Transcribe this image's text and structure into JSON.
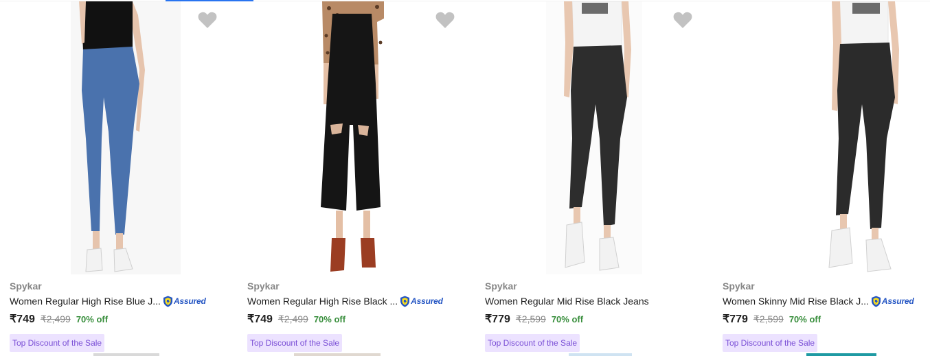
{
  "products": [
    {
      "brand": "Spykar",
      "title": "Women Regular High Rise Blue J...",
      "assured": "Assured",
      "price": "₹749",
      "mrp": "₹2,499",
      "discount": "70% off",
      "badge": "Top Discount of the Sale",
      "jeans_color": "#4a72ad"
    },
    {
      "brand": "Spykar",
      "title": "Women Regular High Rise Black ...",
      "assured": "Assured",
      "price": "₹749",
      "mrp": "₹2,499",
      "discount": "70% off",
      "badge": "Top Discount of the Sale",
      "jeans_color": "#151515"
    },
    {
      "brand": "Spykar",
      "title": "Women Regular Mid Rise Black Jeans",
      "assured": "",
      "price": "₹779",
      "mrp": "₹2,599",
      "discount": "70% off",
      "badge": "Top Discount of the Sale",
      "jeans_color": "#2d2d2d"
    },
    {
      "brand": "Spykar",
      "title": "Women Skinny Mid Rise Black J...",
      "assured": "Assured",
      "price": "₹779",
      "mrp": "₹2,599",
      "discount": "70% off",
      "badge": "Top Discount of the Sale",
      "jeans_color": "#2b2b2b"
    }
  ],
  "icons": {
    "wishlist": "heart-icon",
    "assured": "assured-shield-icon"
  },
  "colors": {
    "accent": "#2874f0",
    "discount": "#388e3c",
    "badge_bg": "#ece2ff",
    "badge_text": "#7a4fd6",
    "muted": "#878787",
    "assured": "#2455c3"
  }
}
